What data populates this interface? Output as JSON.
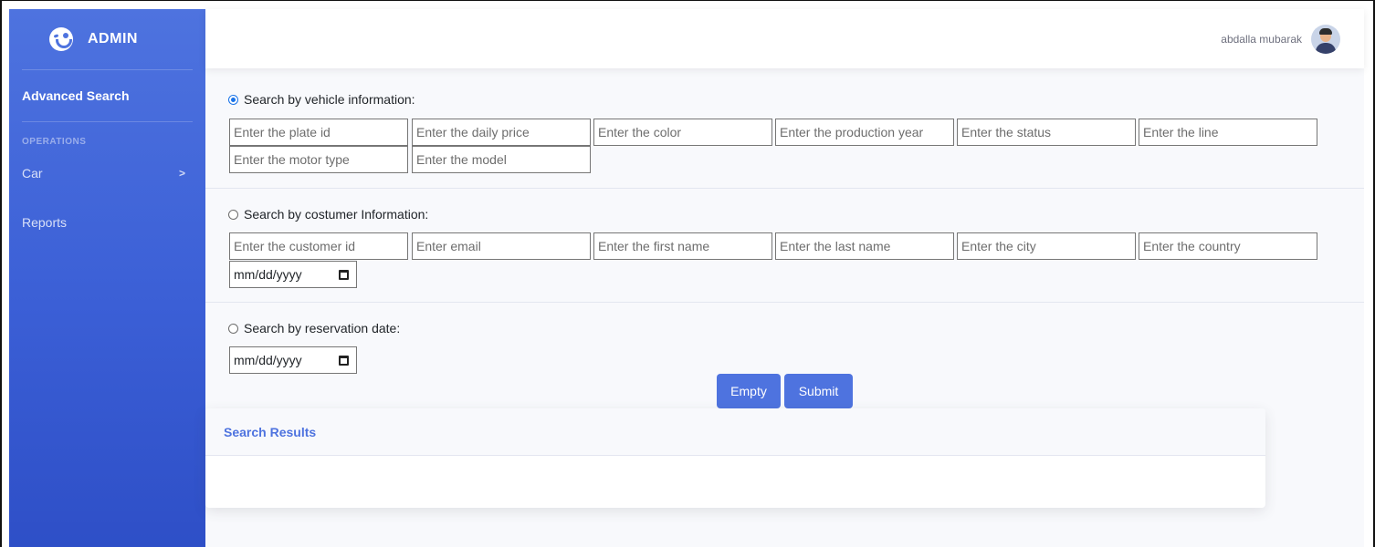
{
  "brand": {
    "title": "ADMIN",
    "icon": "laughing-face-icon"
  },
  "sidebar": {
    "active_item": "Advanced Search",
    "section_heading": "OPERATIONS",
    "items": [
      {
        "label": "Car",
        "has_submenu": true
      },
      {
        "label": "Reports",
        "has_submenu": false
      }
    ]
  },
  "topbar": {
    "user_name": "abdalla mubarak"
  },
  "search": {
    "vehicle": {
      "label": "Search by vehicle information:",
      "selected": true,
      "fields": [
        "Enter the plate id",
        "Enter the daily price",
        "Enter the color",
        "Enter the production year",
        "Enter the status",
        "Enter the line",
        "Enter the motor type",
        "Enter the model"
      ]
    },
    "customer": {
      "label": "Search by costumer Information:",
      "selected": false,
      "fields": [
        "Enter the customer id",
        "Enter email",
        "Enter the first name",
        "Enter the last name",
        "Enter the city",
        "Enter the country"
      ],
      "date_placeholder": "mm/dd/yyyy"
    },
    "reservation": {
      "label": "Search by reservation date:",
      "selected": false,
      "date_placeholder": "mm/dd/yyyy"
    },
    "buttons": {
      "empty": "Empty",
      "submit": "Submit"
    }
  },
  "results": {
    "title": "Search Results"
  },
  "colors": {
    "primary": "#4e73df",
    "background": "#f8f9fc"
  }
}
